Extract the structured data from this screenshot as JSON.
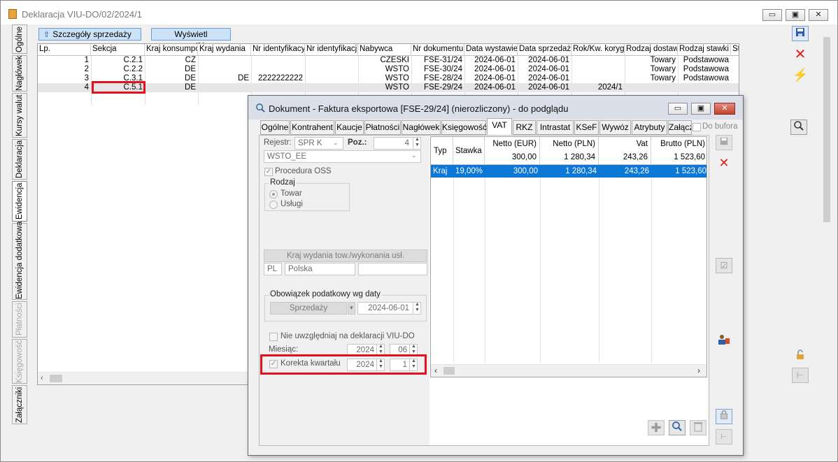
{
  "main_window": {
    "title": "Deklaracja VIU-DO/02/2024/1",
    "min_glyph": "▭",
    "max_glyph": "▣",
    "close_glyph": "✕"
  },
  "vertical_tabs": [
    "Ogólne",
    "Nagłówek",
    "Kursy walut",
    "Deklaracja",
    "Ewidencja",
    "Ewidencja dodatkowa",
    "Płatności",
    "Księgowość",
    "Załączniki"
  ],
  "toolbar": {
    "details_label": "Szczegóły sprzedaży",
    "show_all_label": "Wyświetl wszystkie"
  },
  "grid": {
    "columns": [
      "Lp.",
      "Sekcja",
      "Kraj konsumpc",
      "Kraj wydania",
      "Nr identyfikacy",
      "Nr identyfikacji",
      "Nabywca",
      "Nr dokumentu",
      "Data wystawie",
      "Data sprzedaż",
      "Rok/Kw. koryg",
      "Rodzaj dostaw",
      "Rodzaj stawki",
      "St"
    ],
    "rows": [
      {
        "lp": "1",
        "sekcja": "C.2.1",
        "kraj_konsumpcji": "CZ",
        "kraj_wydania": "",
        "nr_id1": "",
        "nr_id2": "",
        "nabywca": "CZESKI",
        "nr_dokumentu": "FSE-31/24",
        "data_wystawienia": "2024-06-01",
        "data_sprzedazy": "2024-06-01",
        "rok_kw": "",
        "rodzaj_dostaw": "Towary",
        "rodzaj_stawki": "Podstawowa"
      },
      {
        "lp": "2",
        "sekcja": "C.2.2",
        "kraj_konsumpcji": "DE",
        "kraj_wydania": "",
        "nr_id1": "",
        "nr_id2": "",
        "nabywca": "WSTO",
        "nr_dokumentu": "FSE-30/24",
        "data_wystawienia": "2024-06-01",
        "data_sprzedazy": "2024-06-01",
        "rok_kw": "",
        "rodzaj_dostaw": "Towary",
        "rodzaj_stawki": "Podstawowa"
      },
      {
        "lp": "3",
        "sekcja": "C.3.1",
        "kraj_konsumpcji": "DE",
        "kraj_wydania": "DE",
        "nr_id1": "2222222222",
        "nr_id2": "",
        "nabywca": "WSTO",
        "nr_dokumentu": "FSE-28/24",
        "data_wystawienia": "2024-06-01",
        "data_sprzedazy": "2024-06-01",
        "rok_kw": "",
        "rodzaj_dostaw": "Towary",
        "rodzaj_stawki": "Podstawowa"
      },
      {
        "lp": "4",
        "sekcja": "C.5.1",
        "kraj_konsumpcji": "DE",
        "kraj_wydania": "",
        "nr_id1": "",
        "nr_id2": "",
        "nabywca": "WSTO",
        "nr_dokumentu": "FSE-29/24",
        "data_wystawienia": "2024-06-01",
        "data_sprzedazy": "2024-06-01",
        "rok_kw": "2024/1",
        "rodzaj_dostaw": "",
        "rodzaj_stawki": ""
      }
    ]
  },
  "dialog": {
    "title": "Dokument - Faktura eksportowa [FSE-29/24] (nierozliczony) - do podglądu",
    "tabs": [
      "Ogólne",
      "Kontrahent",
      "Kaucje",
      "Płatności",
      "Nagłówek",
      "Księgowość",
      "VAT",
      "RKZ",
      "Intrastat",
      "KSeF",
      "Wywóz",
      "Atrybuty",
      "Załącz"
    ],
    "do_bufora_label": "Do bufora",
    "rejestr_label": "Rejestr:",
    "rejestr_value": "SPR K",
    "poz_label": "Poz.:",
    "poz_value": "4",
    "register_value": "WSTO_EE",
    "procedura_oss_label": "Procedura OSS",
    "rodzaj_label": "Rodzaj",
    "towar_label": "Towar",
    "uslugi_label": "Usługi",
    "kraj_wydania_label": "Kraj wydania tow./wykonania usł.",
    "kraj_code": "PL",
    "kraj_name": "Polska",
    "obowiazek_label": "Obowiązek podatkowy wg daty",
    "sprzedazy_label": "Sprzedaży",
    "obowiazek_date": "2024-06-01",
    "nie_uwzgledniaj_label": "Nie uwzględniaj na deklaracji VIU-DO",
    "miesiac_label": "Miesiąc:",
    "miesiac_year": "2024",
    "miesiac_month": "06",
    "korekta_label": "Korekta kwartału",
    "korekta_year": "2024",
    "korekta_quarter": "1",
    "vat_table": {
      "headers": [
        "Typ",
        "Stawka",
        "Netto (EUR)",
        "Netto (PLN)",
        "Vat",
        "Brutto (PLN)"
      ],
      "totals": {
        "netto_eur": "300,00",
        "netto_pln": "1 280,34",
        "vat": "243,26",
        "brutto_pln": "1 523,60"
      },
      "rows": [
        {
          "typ": "Kraj",
          "stawka": "19,00%",
          "netto_eur": "300,00",
          "netto_pln": "1 280,34",
          "vat": "243,26",
          "brutto_pln": "1 523,60"
        }
      ]
    }
  }
}
